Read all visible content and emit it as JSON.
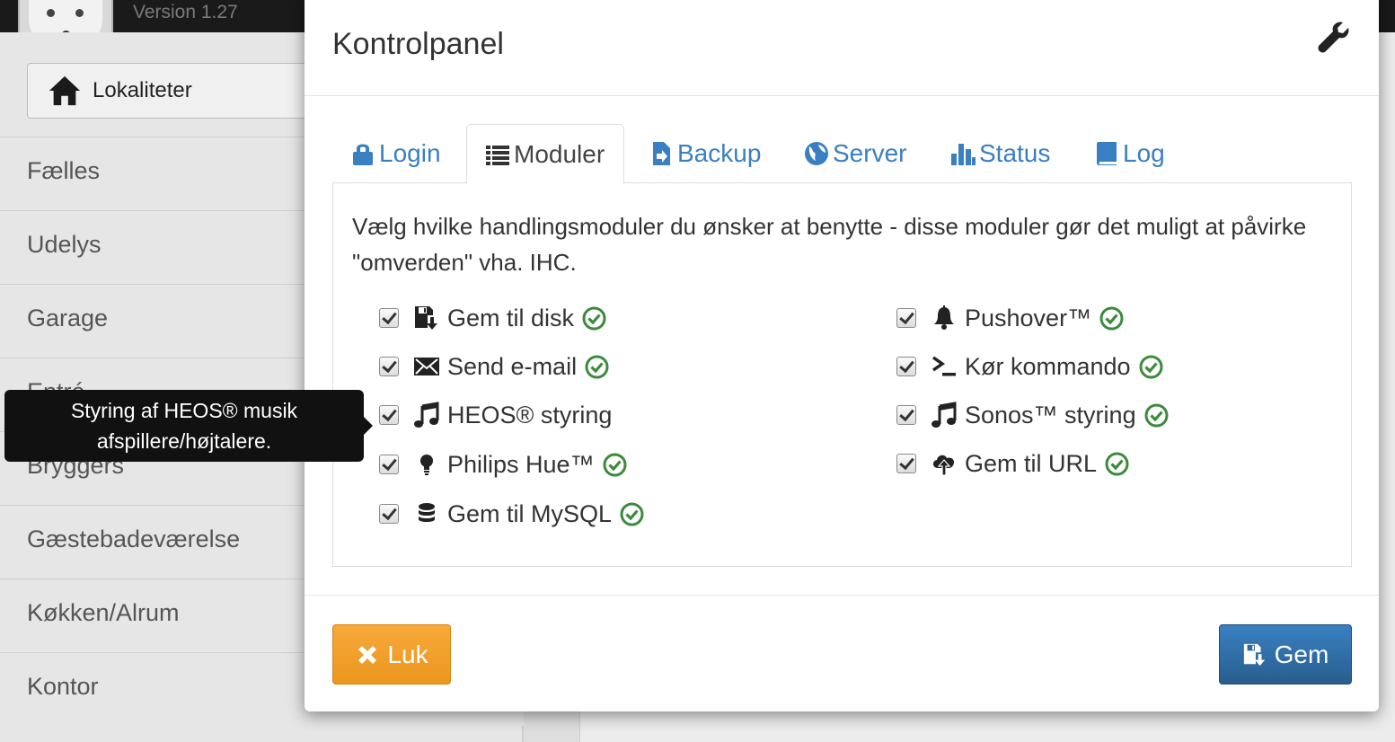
{
  "app": {
    "version": "Version 1.27"
  },
  "sidebar": {
    "locations_button": "Lokaliteter",
    "rooms": [
      "Fælles",
      "Udelys",
      "Garage",
      "Entré",
      "Bryggers",
      "Gæstebadeværelse",
      "Køkken/Alrum",
      "Kontor"
    ]
  },
  "modal": {
    "title": "Kontrolpanel",
    "tabs": [
      {
        "label": "Login",
        "icon": "lock-icon"
      },
      {
        "label": "Moduler",
        "icon": "list-icon",
        "active": true
      },
      {
        "label": "Backup",
        "icon": "file-import-icon"
      },
      {
        "label": "Server",
        "icon": "globe-icon"
      },
      {
        "label": "Status",
        "icon": "bar-chart-icon"
      },
      {
        "label": "Log",
        "icon": "book-icon"
      }
    ],
    "intro": "Vælg hvilke handlingsmoduler du ønsker at benytte - disse moduler gør det muligt at påvirke \"omverden\" vha. IHC.",
    "modules_left": [
      {
        "label": "Gem til disk",
        "icon": "floppy-save-icon",
        "checked": true
      },
      {
        "label": "Send e-mail",
        "icon": "envelope-icon",
        "checked": true
      },
      {
        "label": "HEOS® styring",
        "icon": "music-note-icon",
        "checked": true
      },
      {
        "label": "Philips Hue™",
        "icon": "lightbulb-icon",
        "checked": true
      },
      {
        "label": "Gem til MySQL",
        "icon": "database-icon",
        "checked": true
      }
    ],
    "modules_right": [
      {
        "label": "Pushover™",
        "icon": "bell-icon",
        "checked": true
      },
      {
        "label": "Kør kommando",
        "icon": "terminal-icon",
        "checked": true
      },
      {
        "label": "Sonos™ styring",
        "icon": "music-note-icon",
        "checked": true
      },
      {
        "label": "Gem til URL",
        "icon": "cloud-upload-icon",
        "checked": true
      }
    ],
    "close_button": "Luk",
    "save_button": "Gem"
  },
  "tooltip": {
    "line1": "Styring af HEOS® musik",
    "line2": "afspillere/højtalere."
  },
  "colors": {
    "link": "#3a7fc1",
    "ok": "#3c8a3c",
    "warning": "#ec971f",
    "primary": "#286090"
  }
}
